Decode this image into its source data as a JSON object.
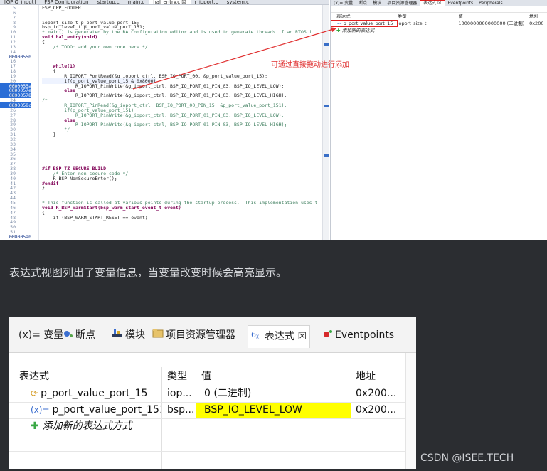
{
  "editor": {
    "tabs": [
      "[GPIO_input]",
      "FSP Configuration",
      "startup.c",
      "main.c",
      "hal_entry.c ☒",
      "r_ioport.c",
      "system.c"
    ],
    "active_tab": "hal_entry.c ☒",
    "gutter_numbers": [
      "5",
      "6",
      "7",
      "8",
      "9",
      "10",
      "11",
      "12",
      "13",
      "14",
      "15",
      "16",
      "17",
      "18",
      "19",
      "20",
      "21",
      "22",
      "23",
      "24",
      "25",
      "26",
      "27",
      "28",
      "29",
      "30",
      "31",
      "32",
      "33",
      "34",
      "35",
      "36",
      "37",
      "38",
      "39",
      "40",
      "41",
      "42",
      "43",
      "44",
      "45",
      "46",
      "47",
      "48",
      "49",
      "50",
      "51",
      "52"
    ],
    "gutter_addresses": {
      "15": "00000550",
      "21": "0000055a",
      "22": "0000057e",
      "23": "00000578",
      "25": "0000058c",
      "52": "000005a0"
    },
    "code_lines": [
      "FSP_CPP_FOOTER",
      "",
      "",
      "ioport_size_t p_port_value_port_15;",
      "bsp_io_level_t p_port_value_port_151;",
      "* main() is generated by the RA Configuration editor and is used to generate threads if an RTOS i",
      "void hal_entry(void)",
      "{",
      "    /* TODO: add your own code here */",
      "",
      "",
      "",
      "    while(1)",
      "    {",
      "        R_IOPORT_PortRead(&g_ioport_ctrl, BSP_IO_PORT_00, &p_port_value_port_15);",
      "        if(p_port_value_port_15 & 0x8000)",
      "            R_IOPORT_PinWrite(&g_ioport_ctrl, BSP_IO_PORT_01_PIN_03, BSP_IO_LEVEL_LOW);",
      "        else",
      "            R_IOPORT_PinWrite(&g_ioport_ctrl, BSP_IO_PORT_01_PIN_03, BSP_IO_LEVEL_HIGH);",
      "/*",
      "        R_IOPORT_PinRead(&g_ioport_ctrl, BSP_IO_PORT_00_PIN_15, &p_port_value_port_151);",
      "        if(p_port_value_port_151)",
      "            R_IOPORT_PinWrite(&g_ioport_ctrl, BSP_IO_PORT_01_PIN_03, BSP_IO_LEVEL_LOW);",
      "        else",
      "            R_IOPORT_PinWrite(&g_ioport_ctrl, BSP_IO_PORT_01_PIN_03, BSP_IO_LEVEL_HIGH);",
      "        */",
      "    }",
      "",
      "",
      "",
      "",
      "",
      "",
      "#if BSP_TZ_SECURE_BUILD",
      "    /* Enter non-secure code */",
      "    R_BSP_NonSecureEnter();",
      "#endif",
      "}",
      "",
      "",
      "* This function is called at various points during the startup process.  This implementation uses t",
      "void R_BSP_WarmStart(bsp_warm_start_event_t event)",
      "{",
      "    if (BSP_WARM_START_RESET == event)"
    ],
    "annotation": "可通过直接拖动进行添加"
  },
  "small_panel": {
    "tabs": [
      "(x)= 变量",
      "断点",
      "模块",
      "项目资源管理器",
      "表达式 ☒",
      "Eventpoints",
      "Peripherals"
    ],
    "headers": [
      "表达式",
      "类型",
      "值",
      "地址"
    ],
    "row": {
      "expr": "p_port_value_port_15",
      "type": "ioport_size_t",
      "value": "1000000000000000 (二进制)",
      "addr": "0x200"
    },
    "add_label": "添加新的表达式"
  },
  "caption": "表达式视图列出了变量信息，当变量改变时候会高亮显示。",
  "zoom_panel": {
    "tabs": [
      {
        "icon": "variables-icon",
        "label": "(x)= 变量"
      },
      {
        "icon": "breakpoints-icon",
        "label": "断点"
      },
      {
        "icon": "modules-icon",
        "label": "模块"
      },
      {
        "icon": "project-explorer-icon",
        "label": "项目资源管理器"
      },
      {
        "icon": "expressions-icon",
        "label": "表达式 ☒"
      },
      {
        "icon": "eventpoints-icon",
        "label": "Eventpoints"
      }
    ],
    "headers": {
      "expr": "表达式",
      "type": "类型",
      "value": "值",
      "addr": "地址"
    },
    "rows": [
      {
        "expr": "p_port_value_port_15",
        "type": "iop...",
        "value": "0 (二进制)",
        "addr": "0x200...",
        "highlight": false
      },
      {
        "expr": "p_port_value_port_151",
        "type": "bsp...",
        "value": "BSP_IO_LEVEL_LOW",
        "addr": "0x200...",
        "highlight": true
      }
    ],
    "add_label": "添加新的表达式方式",
    "highlight_color": "#ffff00"
  },
  "watermark": "CSDN @ISEE.TECH",
  "colors": {
    "page_bg": "#2b2d31",
    "annotation": "#e03030",
    "selection": "#2a6dd6"
  }
}
